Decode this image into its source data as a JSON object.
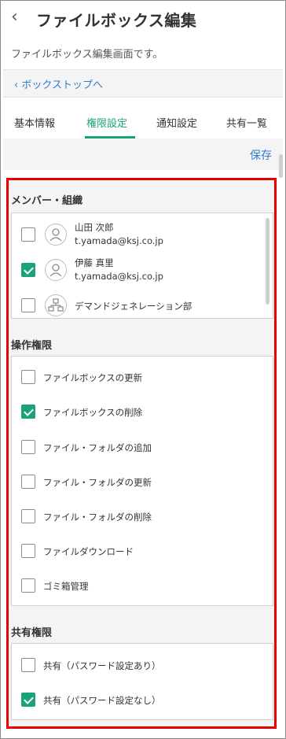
{
  "header": {
    "title": "ファイルボックス編集",
    "subtitle": "ファイルボックス編集画面です。",
    "breadcrumb": "ボックストップへ"
  },
  "tabs": [
    {
      "label": "基本情報",
      "active": false
    },
    {
      "label": "権限設定",
      "active": true
    },
    {
      "label": "通知設定",
      "active": false
    },
    {
      "label": "共有一覧",
      "active": false
    }
  ],
  "save_label": "保存",
  "members": {
    "title": "メンバー・組織",
    "items": [
      {
        "name": "山田 次郎",
        "email": "t.yamada@ksj.co.jp",
        "checked": false,
        "icon": "person-icon"
      },
      {
        "name": "伊藤 真里",
        "email": "t.yamada@ksj.co.jp",
        "checked": true,
        "icon": "person-icon"
      },
      {
        "name": "デマンドジェネレーション部",
        "email": "",
        "checked": false,
        "icon": "org-icon"
      }
    ]
  },
  "operations": {
    "title": "操作権限",
    "items": [
      {
        "label": "ファイルボックスの更新",
        "checked": false
      },
      {
        "label": "ファイルボックスの削除",
        "checked": true
      },
      {
        "label": "ファイル・フォルダの追加",
        "checked": false
      },
      {
        "label": "ファイル・フォルダの更新",
        "checked": false
      },
      {
        "label": "ファイル・フォルダの削除",
        "checked": false
      },
      {
        "label": "ファイルダウンロード",
        "checked": false
      },
      {
        "label": "ゴミ箱管理",
        "checked": false
      }
    ]
  },
  "sharing": {
    "title": "共有権限",
    "items": [
      {
        "label": "共有（パスワード設定あり）",
        "checked": false
      },
      {
        "label": "共有（パスワード設定なし）",
        "checked": true
      }
    ]
  },
  "colors": {
    "accent": "#1aa37a",
    "link": "#2f7ccf",
    "highlight": "#e60000"
  }
}
